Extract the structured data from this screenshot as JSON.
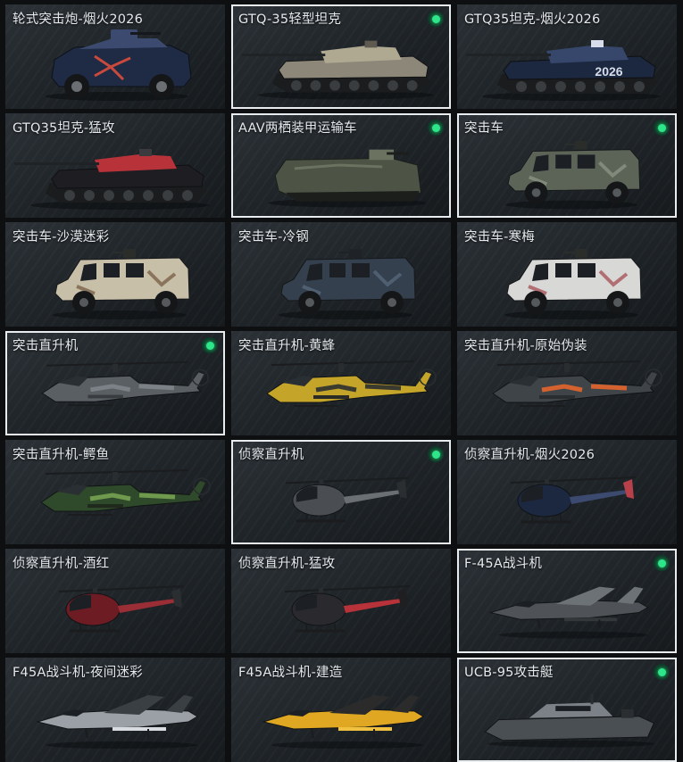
{
  "tiles": [
    {
      "label": "轮式突击炮-烟火2026",
      "kind": "wheeled",
      "equipped": false,
      "c1": "#1f2a44",
      "c2": "#3b4a6e",
      "c3": "#c94a3c"
    },
    {
      "label": "GTQ-35轻型坦克",
      "kind": "tank",
      "equipped": true,
      "c1": "#8c8778",
      "c2": "#b0a992",
      "c3": "#5e5a4f"
    },
    {
      "label": "GTQ35坦克-烟火2026",
      "kind": "tank",
      "equipped": false,
      "c1": "#1c2740",
      "c2": "#37476b",
      "c3": "#d7ddea",
      "text": "2026"
    },
    {
      "label": "GTQ35坦克-猛攻",
      "kind": "tank",
      "equipped": false,
      "c1": "#1e1e22",
      "c2": "#b8323a",
      "c3": "#3a3a3f"
    },
    {
      "label": "AAV两栖装甲运输车",
      "kind": "amph",
      "equipped": true,
      "c1": "#4d5446",
      "c2": "#6b7360",
      "c3": "#30352c"
    },
    {
      "label": "突击车",
      "kind": "mrap",
      "equipped": true,
      "c1": "#5c6457",
      "c2": "#8a9283",
      "c3": "#2a2d2a"
    },
    {
      "label": "突击车-沙漠迷彩",
      "kind": "mrap",
      "equipped": false,
      "c1": "#c8bfa9",
      "c2": "#7a6248",
      "c3": "#2a2d2a"
    },
    {
      "label": "突击车-冷钢",
      "kind": "mrap",
      "equipped": false,
      "c1": "#34404e",
      "c2": "#56677a",
      "c3": "#1f2227"
    },
    {
      "label": "突击车-寒梅",
      "kind": "mrap",
      "equipped": false,
      "c1": "#d8d8d6",
      "c2": "#a8555a",
      "c3": "#2a2d2a"
    },
    {
      "label": "突击直升机",
      "kind": "apache",
      "equipped": true,
      "c1": "#5a5f64",
      "c2": "#7b8187",
      "c3": "#3a3d40"
    },
    {
      "label": "突击直升机-黄蜂",
      "kind": "apache",
      "equipped": false,
      "c1": "#c4a52a",
      "c2": "#3b3a2e",
      "c3": "#2a2a26"
    },
    {
      "label": "突击直升机-原始伪装",
      "kind": "apache",
      "equipped": false,
      "c1": "#3f4448",
      "c2": "#d4622e",
      "c3": "#2a2d30"
    },
    {
      "label": "突击直升机-鳄鱼",
      "kind": "apache",
      "equipped": false,
      "c1": "#2f4a2a",
      "c2": "#6f9a4e",
      "c3": "#1f2a1c"
    },
    {
      "label": "侦察直升机",
      "kind": "scout",
      "equipped": true,
      "c1": "#4a4e52",
      "c2": "#6a6f74",
      "c3": "#2b2e31"
    },
    {
      "label": "侦察直升机-烟火2026",
      "kind": "scout",
      "equipped": false,
      "c1": "#1c2740",
      "c2": "#3b4a6e",
      "c3": "#b8404a"
    },
    {
      "label": "侦察直升机-酒红",
      "kind": "scout",
      "equipped": false,
      "c1": "#6e1c24",
      "c2": "#9a2e36",
      "c3": "#2b2e31"
    },
    {
      "label": "侦察直升机-猛攻",
      "kind": "scout",
      "equipped": false,
      "c1": "#2a2a2e",
      "c2": "#b8323a",
      "c3": "#1f1f22"
    },
    {
      "label": "F-45A战斗机",
      "kind": "jet",
      "equipped": true,
      "c1": "#4f5357",
      "c2": "#6d7277",
      "c3": "#34373a"
    },
    {
      "label": "F45A战斗机-夜间迷彩",
      "kind": "jet",
      "equipped": false,
      "c1": "#9aa0a6",
      "c2": "#3a3f44",
      "c3": "#d8dce0"
    },
    {
      "label": "F45A战斗机-建造",
      "kind": "jet",
      "equipped": false,
      "c1": "#e0a822",
      "c2": "#2b2b2b",
      "c3": "#f0c040"
    },
    {
      "label": "UCB-95攻击艇",
      "kind": "boat",
      "equipped": true,
      "c1": "#4a4f54",
      "c2": "#7b8187",
      "c3": "#2b2e31"
    }
  ]
}
